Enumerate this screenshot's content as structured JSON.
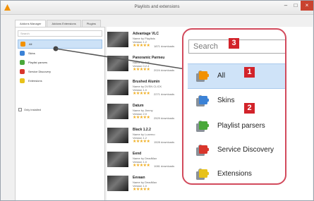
{
  "window": {
    "title": "Playlists and extensions"
  },
  "tabs": [
    {
      "label": "Addons Manager",
      "active": true
    },
    {
      "label": "Addons Extensions",
      "active": false
    },
    {
      "label": "Plugins",
      "active": false
    }
  ],
  "left_panel": {
    "search_placeholder": "Search",
    "categories": [
      {
        "label": "All",
        "icon": "puzzle-orange-icon",
        "color": "#f29100",
        "selected": true
      },
      {
        "label": "Skins",
        "icon": "puzzle-blue-icon",
        "color": "#3b82d6"
      },
      {
        "label": "Playlist parsers",
        "icon": "puzzle-green-icon",
        "color": "#4aa83a"
      },
      {
        "label": "Service Discovery",
        "icon": "puzzle-red-icon",
        "color": "#d9362c"
      },
      {
        "label": "Extensions",
        "icon": "puzzle-yellow-icon",
        "color": "#e8c21a"
      }
    ],
    "only_installed_label": "Only installed"
  },
  "extensions": [
    {
      "name": "Advantage VLC",
      "author": "Name by Playlists",
      "version": "Version 1.2",
      "rating": 4,
      "downloads": "1871 downloads"
    },
    {
      "name": "Panoramic Parmeu",
      "author": "Name by Jeff",
      "version": "Version 0.2.4",
      "rating": 4,
      "downloads": "2024 downloads"
    },
    {
      "name": "Brushed Alumin",
      "author": "Name by DVSN CLICK",
      "version": "Version 1.0",
      "rating": 4,
      "downloads": "2271 downloads"
    },
    {
      "name": "Datum",
      "author": "Name by Jimmy",
      "version": "Version 2.0",
      "rating": 4,
      "downloads": "2529 downloads"
    },
    {
      "name": "Black 1.2.2",
      "author": "Name by Luxerno",
      "version": "Version 1.2",
      "rating": 4,
      "downloads": "1528 downloads"
    },
    {
      "name": "Eend",
      "author": "Name by DeadMax",
      "version": "Version 1.0",
      "rating": 4,
      "downloads": "1081 downloads"
    },
    {
      "name": "Eevaan",
      "author": "Name by DeadMax",
      "version": "Version 1.0",
      "rating": 4,
      "downloads": ""
    }
  ],
  "zoom": {
    "search_placeholder": "Search",
    "items": [
      {
        "label": "All",
        "icon": "puzzle-orange-icon",
        "color": "#f29100",
        "selected": true
      },
      {
        "label": "Skins",
        "icon": "puzzle-blue-icon",
        "color": "#3b82d6"
      },
      {
        "label": "Playlist parsers",
        "icon": "puzzle-green-icon",
        "color": "#4aa83a"
      },
      {
        "label": "Service Discovery",
        "icon": "puzzle-red-icon",
        "color": "#d9362c"
      },
      {
        "label": "Extensions",
        "icon": "puzzle-yellow-icon",
        "color": "#e8c21a"
      }
    ]
  },
  "badges": {
    "search": "3",
    "all": "1",
    "categories": "2"
  },
  "colors": {
    "callout_border": "#d24a5c",
    "badge": "#d2232a",
    "selection": "#cfe3f8"
  }
}
